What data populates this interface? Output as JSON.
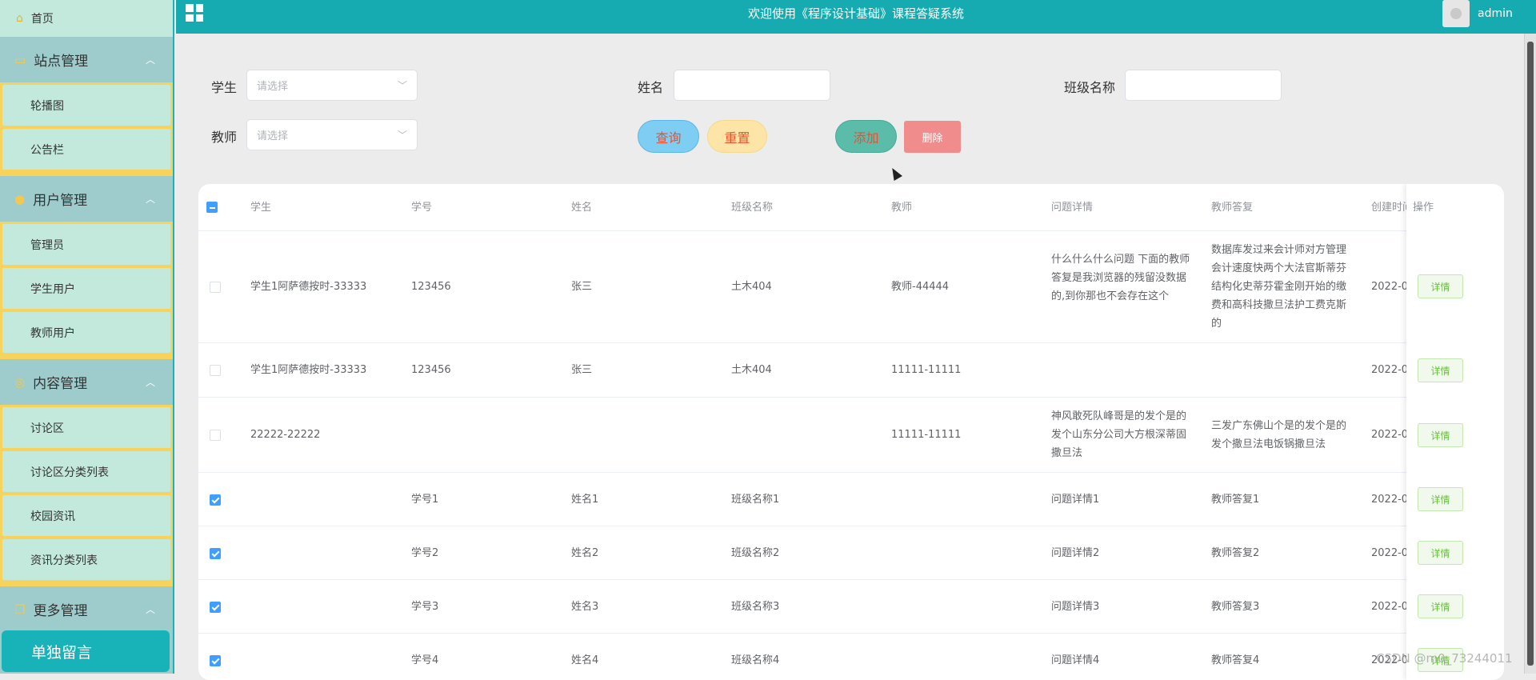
{
  "header": {
    "title": "欢迎使用《程序设计基础》课程答疑系统",
    "username": "admin"
  },
  "sidebar": {
    "home": "首页",
    "groups": [
      {
        "label": "站点管理",
        "items": [
          "轮播图",
          "公告栏"
        ]
      },
      {
        "label": "用户管理",
        "items": [
          "管理员",
          "学生用户",
          "教师用户"
        ]
      },
      {
        "label": "内容管理",
        "items": [
          "讨论区",
          "讨论区分类列表",
          "校园资讯",
          "资讯分类列表"
        ]
      },
      {
        "label": "更多管理",
        "items": []
      }
    ],
    "special": "单独留言"
  },
  "search": {
    "student_label": "学生",
    "student_placeholder": "请选择",
    "name_label": "姓名",
    "class_label": "班级名称",
    "teacher_label": "教师",
    "teacher_placeholder": "请选择",
    "query": "查询",
    "reset": "重置",
    "add": "添加",
    "delete": "删除"
  },
  "table": {
    "columns": [
      "学生",
      "学号",
      "姓名",
      "班级名称",
      "教师",
      "问题详情",
      "教师答复",
      "创建时间",
      "操作"
    ],
    "rows": [
      {
        "checked": false,
        "student": "学生1阿萨德按时-33333",
        "sid": "123456",
        "name": "张三",
        "cls": "土木404",
        "teacher": "教师-44444",
        "question": "什么什么什么问题 下面的教师答复是我浏览器的残留没数据的,到你那也不会存在这个",
        "reply": "数据库发过来会计师对方管理会计速度快两个大法官斯蒂芬结构化史蒂芬霍金刚开始的缴费和高科技撒旦法护工费克斯的",
        "created": "2022-0"
      },
      {
        "checked": false,
        "student": "学生1阿萨德按时-33333",
        "sid": "123456",
        "name": "张三",
        "cls": "土木404",
        "teacher": "11111-11111",
        "question": "",
        "reply": "",
        "created": "2022-0"
      },
      {
        "checked": false,
        "student": "22222-22222",
        "sid": "",
        "name": "",
        "cls": "",
        "teacher": "11111-11111",
        "question": "神风敢死队峰哥是的发个是的发个山东分公司大方根深蒂固撒旦法",
        "reply": "三发广东佛山个是的发个是的发个撒旦法电饭锅撒旦法",
        "created": "2022-0"
      },
      {
        "checked": true,
        "student": "",
        "sid": "学号1",
        "name": "姓名1",
        "cls": "班级名称1",
        "teacher": "",
        "question": "问题详情1",
        "reply": "教师答复1",
        "created": "2022-0"
      },
      {
        "checked": true,
        "student": "",
        "sid": "学号2",
        "name": "姓名2",
        "cls": "班级名称2",
        "teacher": "",
        "question": "问题详情2",
        "reply": "教师答复2",
        "created": "2022-0"
      },
      {
        "checked": true,
        "student": "",
        "sid": "学号3",
        "name": "姓名3",
        "cls": "班级名称3",
        "teacher": "",
        "question": "问题详情3",
        "reply": "教师答复3",
        "created": "2022-0"
      },
      {
        "checked": true,
        "student": "",
        "sid": "学号4",
        "name": "姓名4",
        "cls": "班级名称4",
        "teacher": "",
        "question": "问题详情4",
        "reply": "教师答复4",
        "created": "2022-0"
      }
    ],
    "detail_label": "详情"
  },
  "watermark": "CSDN @m0_73244011",
  "colors": {
    "sidebar": "#9ecbcc",
    "header": "#15abb0",
    "item_bg": "#c3e9dc",
    "item_border": "#f7d35c",
    "query_btn": "#7ecef4",
    "reset_btn": "#fde5a8",
    "add_btn": "#5cbcaa",
    "delete_btn": "#f08c8c"
  }
}
